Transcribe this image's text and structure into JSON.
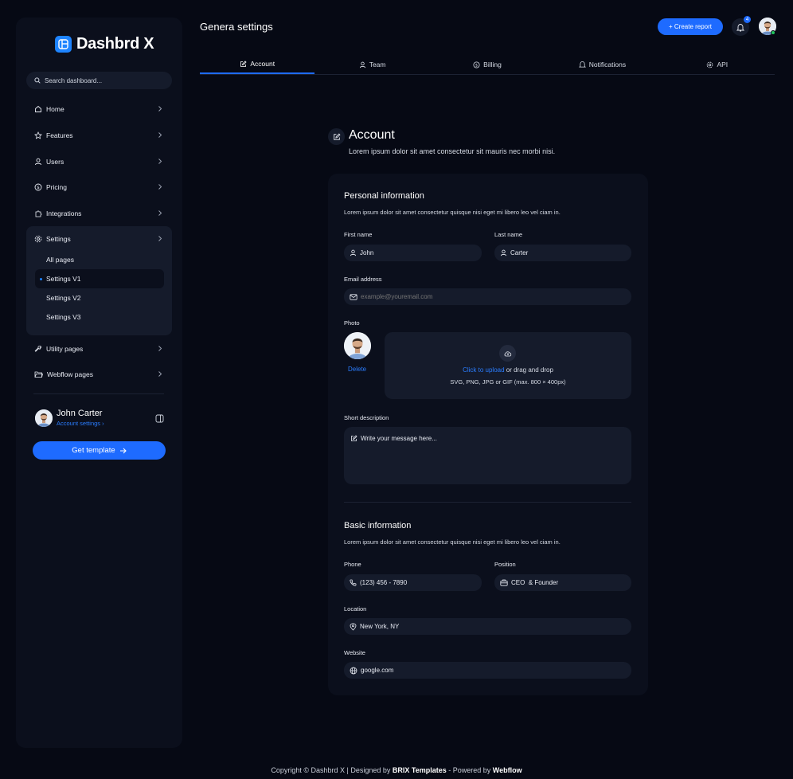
{
  "sidebar": {
    "brand": "Dashbrd X",
    "search_placeholder": "Search dashboard...",
    "items": [
      {
        "label": "Home"
      },
      {
        "label": "Features"
      },
      {
        "label": "Users"
      },
      {
        "label": "Pricing"
      },
      {
        "label": "Integrations"
      },
      {
        "label": "Settings"
      }
    ],
    "settings_sub": [
      {
        "label": "All pages"
      },
      {
        "label": "Settings V1"
      },
      {
        "label": "Settings V2"
      },
      {
        "label": "Settings V3"
      }
    ],
    "bottom_items": [
      {
        "label": "Utility pages"
      },
      {
        "label": "Webflow pages"
      }
    ],
    "user": {
      "name": "John Carter",
      "link": "Account settings"
    },
    "cta": "Get template"
  },
  "header": {
    "title": "Genera settings",
    "create_label": "+ Create report",
    "notifications_count": "4"
  },
  "tabs": [
    {
      "label": "Account"
    },
    {
      "label": "Team"
    },
    {
      "label": "Billing"
    },
    {
      "label": "Notifications"
    },
    {
      "label": "API"
    }
  ],
  "account": {
    "title": "Account",
    "subtitle": "Lorem ipsum dolor sit amet consectetur sit mauris nec morbi nisi."
  },
  "personal": {
    "title": "Personal information",
    "subtitle": "Lorem ipsum dolor sit amet consectetur quisque nisi eget mi libero leo vel ciam in.",
    "first_name_label": "First name",
    "first_name_value": "John",
    "last_name_label": "Last name",
    "last_name_value": "Carter",
    "email_label": "Email address",
    "email_placeholder": "example@youremail.com",
    "photo_label": "Photo",
    "delete_label": "Delete",
    "upload_link": "Click to upload",
    "upload_text": " or drag and drop",
    "upload_hint": "SVG, PNG, JPG or GIF (max. 800 × 400px)",
    "desc_label": "Short description",
    "desc_placeholder": "Write your message here..."
  },
  "basic": {
    "title": "Basic information",
    "subtitle": "Lorem ipsum dolor sit amet consectetur quisque nisi eget mi libero leo vel ciam in.",
    "phone_label": "Phone",
    "phone_value": "(123) 456 - 7890",
    "position_label": "Position",
    "position_value": "CEO  & Founder",
    "location_label": "Location",
    "location_value": "New York, NY",
    "website_label": "Website",
    "website_value": "google.com"
  },
  "footer": {
    "copyright": "Copyright © Dashbrd X | Designed by ",
    "brix": "BRIX Templates",
    "powered": " - Powered by ",
    "webflow": "Webflow"
  },
  "colors": {
    "background": "#060914",
    "panel": "#0b0f1c",
    "field": "#151b2b",
    "accent": "#1e6bff",
    "link": "#2a7dff"
  }
}
